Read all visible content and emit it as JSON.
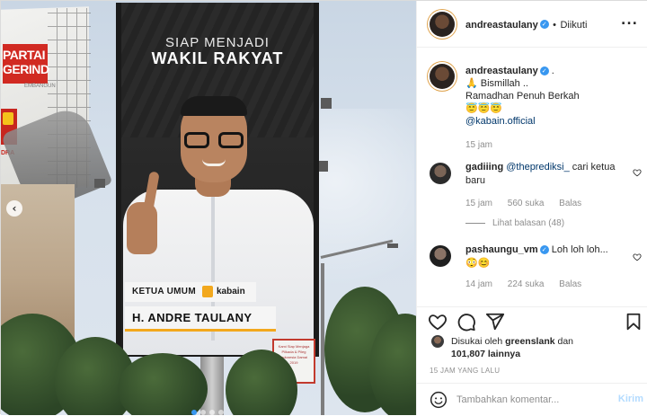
{
  "photo": {
    "billboard_line1": "SIAP MENJADI",
    "billboard_line2": "WAKIL RAKYAT",
    "position_label": "KETUA UMUM",
    "org_label": "kabain",
    "name_label": "H. ANDRE TAULANY",
    "old_board_text": "PARTAI\nGERIND",
    "old_board_sub": "EMBANGUN",
    "old_board_logo_text": "DRA",
    "sign_text": "Kami Siap Menjaga\nPilkada & Pileg\nIndonesia Damai\n2019",
    "carousel": {
      "total": 4,
      "active": 1
    }
  },
  "header": {
    "username": "andreastaulany",
    "separator": "•",
    "follow_label": "Diikuti",
    "more": "..."
  },
  "caption": {
    "username": "andreastaulany",
    "suffix": ".",
    "line1": "🙏 Bismillah ..",
    "line2": "Ramadhan Penuh Berkah",
    "line3": "😇😇😇",
    "mention": "@kabain.official",
    "time": "15 jam"
  },
  "comments": [
    {
      "username": "gadiiing",
      "mention": "@theprediksi_",
      "text": " cari ketua baru",
      "time": "15 jam",
      "likes": "560 suka",
      "reply": "Balas",
      "view_replies": "Lihat balasan (48)"
    },
    {
      "username": "pashaungu_vm",
      "text": " Loh loh loh...",
      "emoji": "😳😊",
      "time": "14 jam",
      "likes": "224 suka",
      "reply": "Balas"
    }
  ],
  "actions": {
    "liked_by_prefix": "Disukai oleh ",
    "liked_by_user": "greenslank",
    "liked_by_mid": " dan",
    "liked_by_count": "101,807 lainnya",
    "posted": "15 JAM YANG LALU",
    "comment_placeholder": "Tambahkan komentar...",
    "send_label": "Kirim"
  },
  "colors": {
    "link": "#00376b",
    "verified": "#3897f0",
    "muted": "#8e8e8e",
    "send_disabled": "#b3dbff",
    "billboard_accent": "#f2a81d"
  }
}
